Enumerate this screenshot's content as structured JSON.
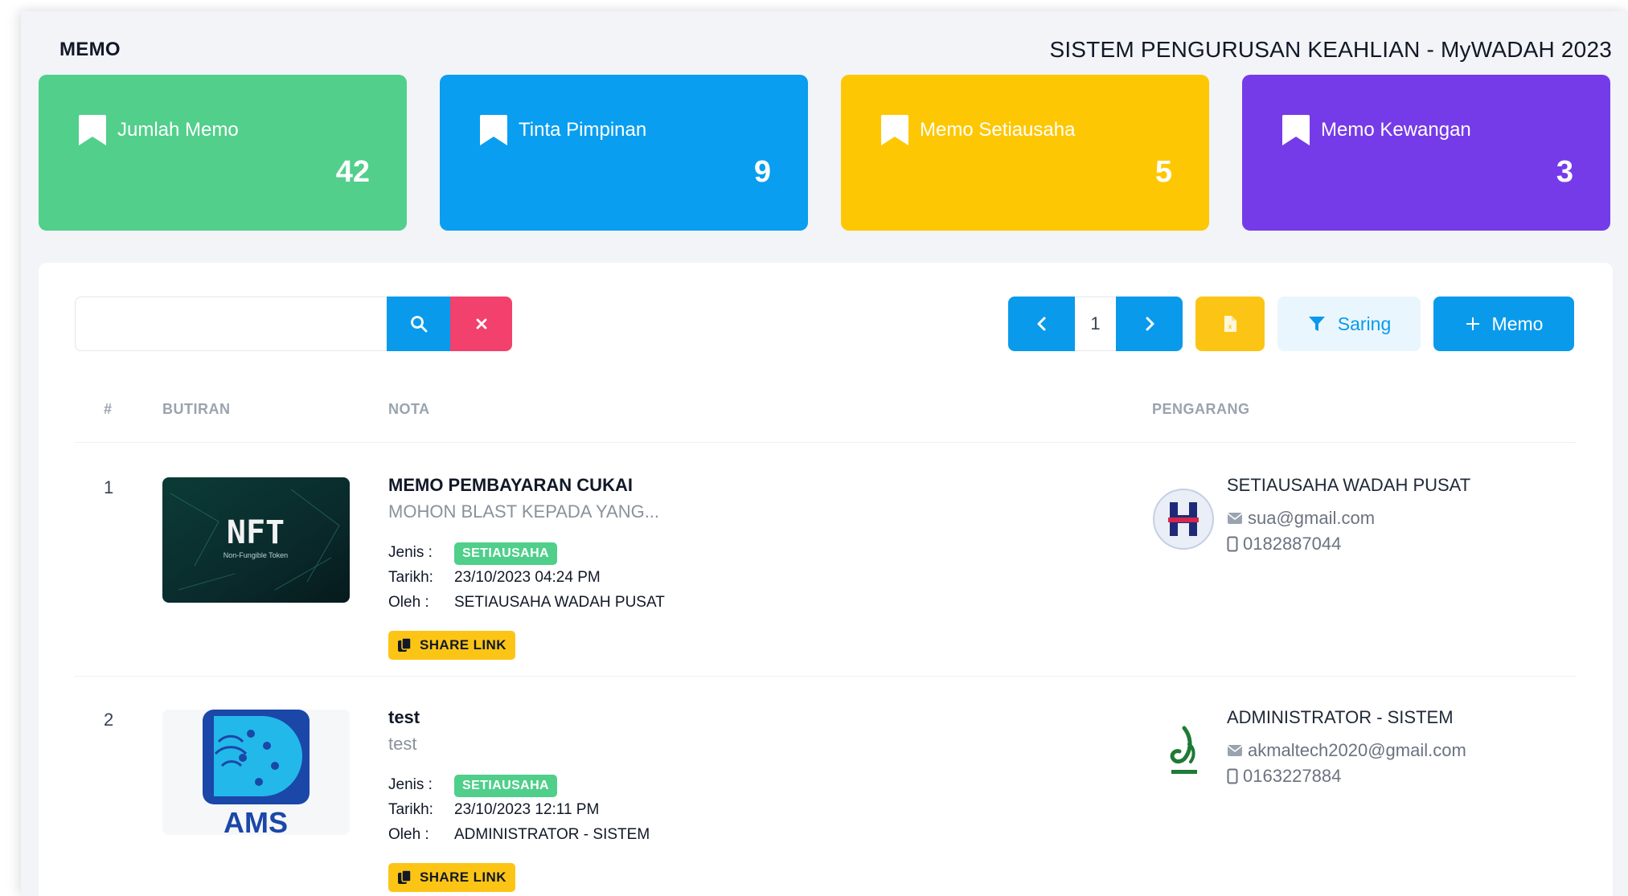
{
  "header": {
    "page_label": "MEMO",
    "system_title": "SISTEM PENGURUSAN KEAHLIAN - MyWADAH 2023"
  },
  "stats": [
    {
      "title": "Jumlah Memo",
      "value": "42",
      "color": "#52cf8b"
    },
    {
      "title": "Tinta Pimpinan",
      "value": "9",
      "color": "#099ef0"
    },
    {
      "title": "Memo Setiausaha",
      "value": "5",
      "color": "#fec703"
    },
    {
      "title": "Memo Kewangan",
      "value": "3",
      "color": "#763be8"
    }
  ],
  "search": {
    "value": "",
    "placeholder": ""
  },
  "pagination": {
    "current_page": "1"
  },
  "toolbar": {
    "filter_label": "Saring",
    "add_label": "Memo"
  },
  "table": {
    "columns": {
      "index": "#",
      "details": "BUTIRAN",
      "note": "NOTA",
      "author": "PENGARANG"
    },
    "labels": {
      "type": "Jenis :",
      "date": "Tarikh:",
      "by": "Oleh  :",
      "share": "SHARE LINK"
    },
    "rows": [
      {
        "index": "1",
        "thumbnail_text": "NFT",
        "thumbnail_caption": "Non-Fungible Token",
        "title": "MEMO PEMBAYARAN CUKAI",
        "summary": "MOHON BLAST KEPADA YANG...",
        "type": "SETIAUSAHA",
        "date": "23/10/2023 04:24 PM",
        "by": "SETIAUSAHA WADAH PUSAT",
        "author_name": "SETIAUSAHA WADAH PUSAT",
        "author_email": "sua@gmail.com",
        "author_phone": "0182887044"
      },
      {
        "index": "2",
        "thumbnail_text": "AMS",
        "thumbnail_caption": "",
        "title": "test",
        "summary": "test",
        "type": "SETIAUSAHA",
        "date": "23/10/2023 12:11 PM",
        "by": "ADMINISTRATOR - SISTEM",
        "author_name": "ADMINISTRATOR - SISTEM",
        "author_email": "akmaltech2020@gmail.com",
        "author_phone": "0163227884"
      }
    ]
  },
  "icons": {
    "stat_icon": "bookmark-icon",
    "search": "search-icon",
    "clear": "close-icon",
    "prev": "chevron-left-icon",
    "next": "chevron-right-icon",
    "export": "file-icon",
    "filter": "filter-icon",
    "add": "plus-icon",
    "email": "envelope-icon",
    "phone": "mobile-icon",
    "share": "copy-icon"
  }
}
